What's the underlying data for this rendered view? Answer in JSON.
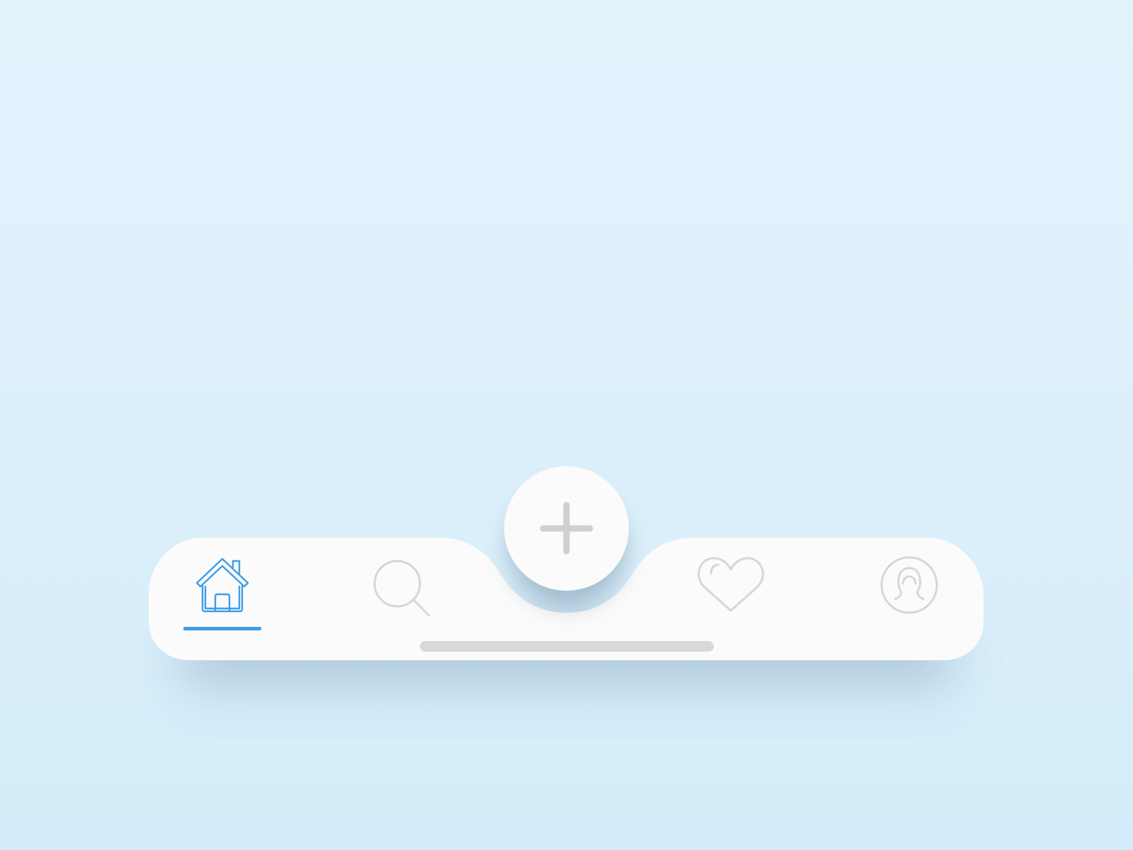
{
  "colors": {
    "active": "#3d9ee8",
    "inactive": "#d6d6d6",
    "bar": "#fbfbfb",
    "notch_shade": "#d3e3ec",
    "plus": "#d0d0d0"
  },
  "tabbar": {
    "active_tab": "home",
    "items": [
      {
        "id": "home",
        "icon": "home-icon"
      },
      {
        "id": "search",
        "icon": "search-icon"
      },
      {
        "id": "favorites",
        "icon": "heart-icon"
      },
      {
        "id": "profile",
        "icon": "user-icon"
      }
    ],
    "add_button": {
      "icon": "plus-icon"
    }
  }
}
